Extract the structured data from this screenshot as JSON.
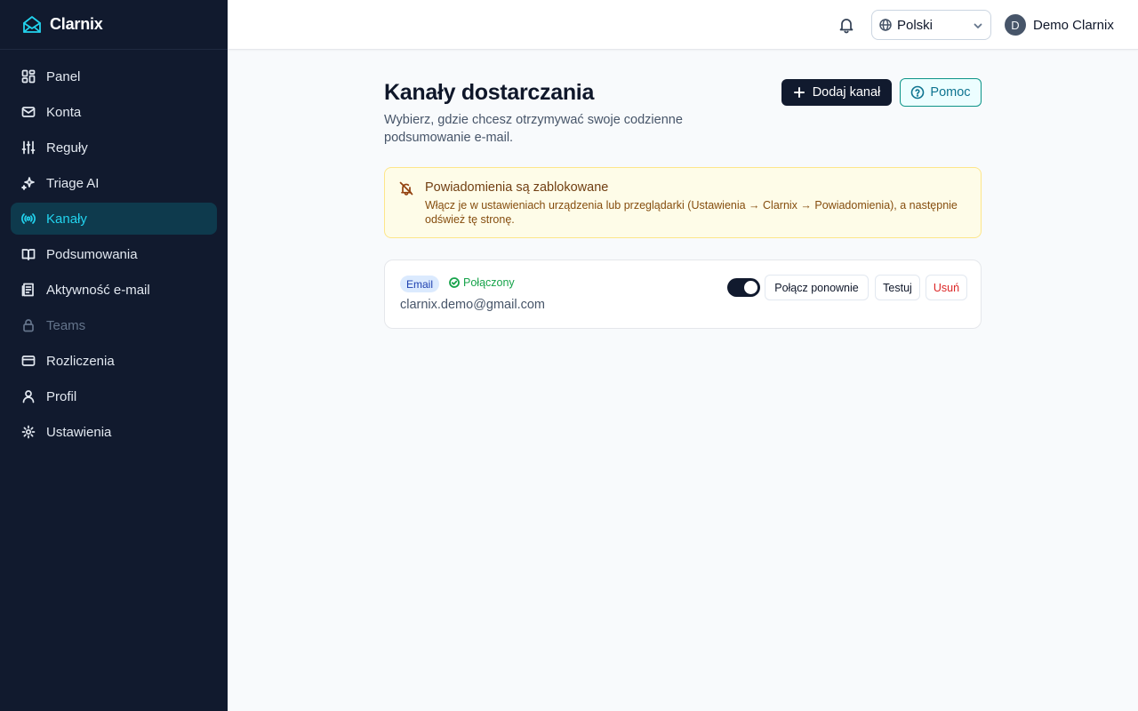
{
  "brand": {
    "name": "Clarnix",
    "accent": "#22d3ee"
  },
  "sidebar": {
    "items": [
      {
        "label": "Panel",
        "icon": "dashboard-icon"
      },
      {
        "label": "Konta",
        "icon": "mail-icon"
      },
      {
        "label": "Reguły",
        "icon": "sliders-icon"
      },
      {
        "label": "Triage AI",
        "icon": "sparkles-icon"
      },
      {
        "label": "Kanały",
        "icon": "radio-icon",
        "active": true
      },
      {
        "label": "Podsumowania",
        "icon": "book-icon"
      },
      {
        "label": "Aktywność e-mail",
        "icon": "receipt-icon"
      },
      {
        "label": "Teams",
        "icon": "lock-icon",
        "disabled": true
      },
      {
        "label": "Rozliczenia",
        "icon": "credit-card-icon"
      },
      {
        "label": "Profil",
        "icon": "user-icon"
      },
      {
        "label": "Ustawienia",
        "icon": "gear-icon"
      }
    ]
  },
  "header": {
    "language": "Polski",
    "user_initial": "D",
    "user_name": "Demo Clarnix"
  },
  "main": {
    "title": "Kanały dostarczania",
    "subtitle": "Wybierz, gdzie chcesz otrzymywać swoje codzienne podsumowanie e-mail.",
    "add_button": "Dodaj kanał",
    "help_button": "Pomoc"
  },
  "alert": {
    "title": "Powiadomienia są zablokowane",
    "text": "Włącz je w ustawieniach urządzenia lub przeglądarki (Ustawienia → Clarnix → Powiadomienia), a następnie odśwież tę stronę."
  },
  "channel": {
    "type": "Email",
    "status": "Połączony",
    "address": "clarnix.demo@gmail.com",
    "enabled": true,
    "reconnect_label": "Połącz ponownie",
    "test_label": "Testuj",
    "delete_label": "Usuń"
  }
}
